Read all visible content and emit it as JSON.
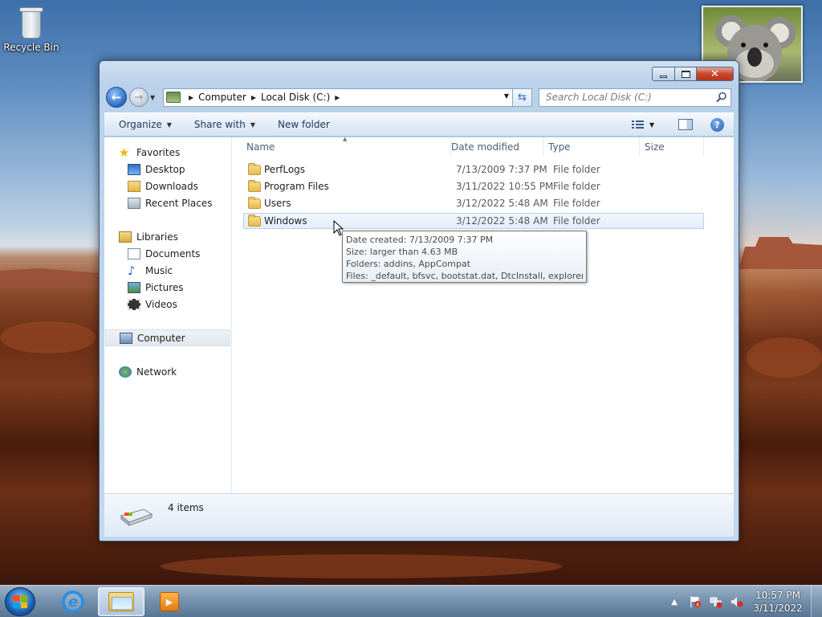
{
  "desktop": {
    "icons": [
      {
        "label": "Recycle Bin",
        "icon": "recycle-bin-icon"
      }
    ],
    "gadget": "koala-photo-gadget"
  },
  "window": {
    "caption_buttons": {
      "minimize": "minimize-icon",
      "maximize": "maximize-icon",
      "close": "✕"
    },
    "nav": {
      "back": "back-arrow-icon",
      "forward": "forward-arrow-icon",
      "breadcrumbs": [
        "Computer",
        "Local Disk (C:)"
      ],
      "search_placeholder": "Search Local Disk (C:)"
    },
    "toolbar": {
      "organize": "Organize",
      "share_with": "Share with",
      "new_folder": "New folder"
    },
    "nav_pane": {
      "favorites": {
        "label": "Favorites",
        "items": [
          "Desktop",
          "Downloads",
          "Recent Places"
        ]
      },
      "libraries": {
        "label": "Libraries",
        "items": [
          "Documents",
          "Music",
          "Pictures",
          "Videos"
        ]
      },
      "computer": "Computer",
      "network": "Network"
    },
    "columns": [
      "Name",
      "Date modified",
      "Type",
      "Size"
    ],
    "files": [
      {
        "name": "PerfLogs",
        "date": "7/13/2009 7:37 PM",
        "type": "File folder",
        "size": ""
      },
      {
        "name": "Program Files",
        "date": "3/11/2022 10:55 PM",
        "type": "File folder",
        "size": ""
      },
      {
        "name": "Users",
        "date": "3/12/2022 5:48 AM",
        "type": "File folder",
        "size": ""
      },
      {
        "name": "Windows",
        "date": "3/12/2022 5:48 AM",
        "type": "File folder",
        "size": ""
      }
    ],
    "tooltip": {
      "line1": "Date created: 7/13/2009 7:37 PM",
      "line2": "Size: larger than 4.63 MB",
      "line3": "Folders: addins, AppCompat",
      "line4": "Files: _default, bfsvc, bootstat.dat, DtcInstall, explorer, ..."
    },
    "details": {
      "item_count": "4 items"
    }
  },
  "taskbar": {
    "apps": [
      "internet-explorer-icon",
      "windows-explorer-icon",
      "media-player-icon"
    ],
    "clock_time": "10:57 PM",
    "clock_date": "3/11/2022"
  },
  "colors": {
    "accent": "#2a6ac5",
    "selection": "#e4eefb",
    "close_red": "#c9462f"
  }
}
